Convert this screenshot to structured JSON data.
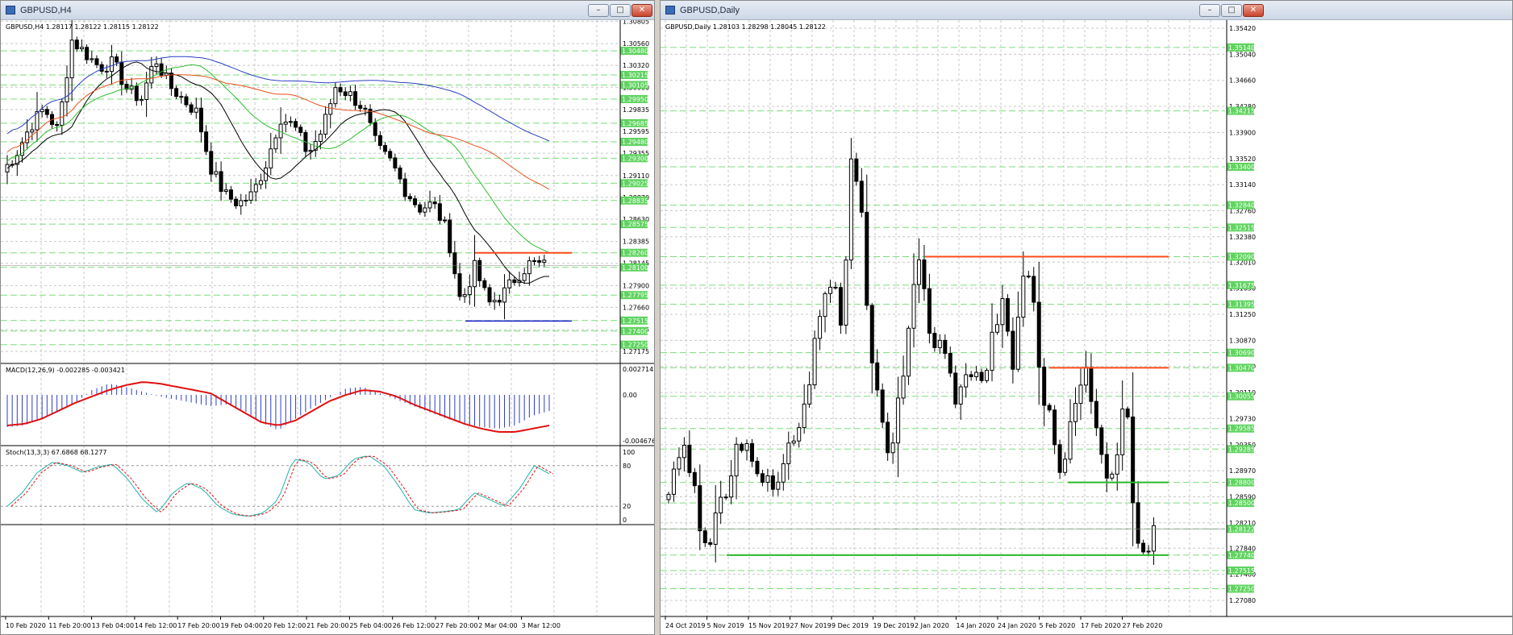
{
  "left": {
    "title": "GBPUSD,H4",
    "info": "GBPUSD,H4  1.28117 1.28122 1.28115 1.28122",
    "price_ticks": [
      "1.30805",
      "1.30560",
      "1.30320",
      "1.30080",
      "1.29835",
      "1.29595",
      "1.29355",
      "1.29110",
      "1.28870",
      "1.28630",
      "1.28385",
      "1.28145",
      "1.27900",
      "1.27660",
      "1.27415",
      "1.27175"
    ],
    "level_labels": [
      "1.30480",
      "1.30215",
      "1.30105",
      "1.29950",
      "1.29685",
      "1.29480",
      "1.29300",
      "1.29025",
      "1.28835",
      "1.28575",
      "1.28260",
      "1.28100",
      "1.27795",
      "1.27515",
      "1.27400",
      "1.27250"
    ],
    "macd_label": "MACD(12,26,9) -0.002285 -0.003421",
    "macd_ticks": [
      "0.002714",
      "0.00",
      "-0.004676"
    ],
    "stoch_label": "Stoch(13,3,3) 67.6868 68.1277",
    "stoch_ticks": [
      "100",
      "80",
      "20",
      "0"
    ],
    "time_labels": [
      "10 Feb 2020",
      "11 Feb 20:00",
      "13 Feb 04:00",
      "14 Feb 12:00",
      "17 Feb 20:00",
      "19 Feb 04:00",
      "20 Feb 12:00",
      "21 Feb 20:00",
      "25 Feb 04:00",
      "26 Feb 12:00",
      "27 Feb 20:00",
      "2 Mar 04:00",
      "3 Mar 12:00"
    ]
  },
  "right": {
    "title": "GBPUSD,Daily",
    "info": "GBPUSD,Daily  1.28103 1.28298 1.28045 1.28122",
    "price_ticks": [
      "1.35420",
      "1.35040",
      "1.34660",
      "1.34280",
      "1.33900",
      "1.33520",
      "1.33140",
      "1.32760",
      "1.32380",
      "1.32010",
      "1.31630",
      "1.31250",
      "1.30870",
      "1.30490",
      "1.30110",
      "1.29730",
      "1.29350",
      "1.28970",
      "1.28590",
      "1.28210",
      "1.27840",
      "1.27460",
      "1.27080"
    ],
    "level_labels": [
      "1.35140",
      "1.34215",
      "1.33400",
      "1.32840",
      "1.32515",
      "1.32090",
      "1.31675",
      "1.31395",
      "1.30690",
      "1.30470",
      "1.30055",
      "1.29585",
      "1.29285",
      "1.28800",
      "1.28500",
      "1.28122",
      "1.27740",
      "1.27515",
      "1.27250"
    ],
    "time_labels": [
      "24 Oct 2019",
      "5 Nov 2019",
      "15 Nov 2019",
      "27 Nov 2019",
      "9 Dec 2019",
      "19 Dec 2019",
      "2 Jan 2020",
      "14 Jan 2020",
      "24 Jan 2020",
      "5 Feb 2020",
      "17 Feb 2020",
      "27 Feb 2020"
    ]
  },
  "colors": {
    "grid": "#c8c8c8",
    "level": "#7ddc7d",
    "level_label_bg": "#5fd35f",
    "ma_black": "#000000",
    "ma_green": "#2ebd2e",
    "ma_orange": "#e8501e",
    "ma_blue": "#2b3fc4",
    "macd_hist": "#2b3fc4",
    "macd_signal": "#e01010",
    "stoch_main": "#20b2aa",
    "stoch_signal": "#e01010",
    "res_line": "#ff4a1a",
    "sup_blue": "#1a1ad0",
    "sup_green": "#2ab82a"
  },
  "window_buttons": {
    "minimize": "–",
    "maximize": "□",
    "close": "✕"
  }
}
